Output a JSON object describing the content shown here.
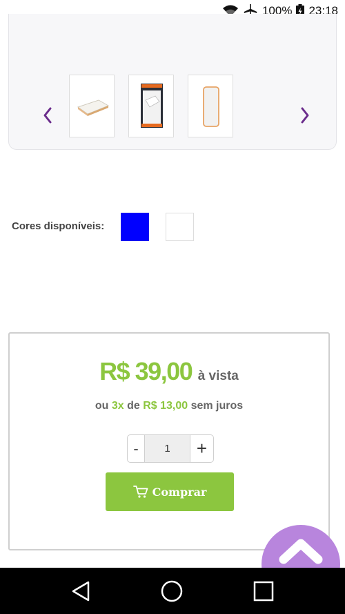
{
  "status_bar": {
    "battery": "100%",
    "time": "23:18",
    "icons": [
      "wifi-icon",
      "airplane-mode-icon",
      "battery-icon"
    ]
  },
  "gallery": {
    "thumbnails": [
      {
        "name": "product-thumbnail-1",
        "depicts": "white power bank lying flat"
      },
      {
        "name": "product-thumbnail-2",
        "depicts": "power bank in retail packaging"
      },
      {
        "name": "product-thumbnail-3",
        "depicts": "white power bank upright"
      }
    ],
    "prev_icon": "chevron-left-icon",
    "next_icon": "chevron-right-icon",
    "arrow_color": "#6b2d8c"
  },
  "colors": {
    "label": "Cores disponíveis:",
    "swatches": [
      "#0000ff",
      "#ffffff"
    ]
  },
  "purchase": {
    "price": "R$ 39,00",
    "price_suffix": "à vista",
    "installments_prefix": "ou",
    "installments_count": "3x",
    "installments_mid": "de",
    "installment_value": "R$ 13,00",
    "installments_suffix": "sem juros",
    "quantity": "1",
    "minus_label": "-",
    "plus_label": "+",
    "buy_label": "Comprar",
    "buy_icon": "cart-icon"
  },
  "scroll_top": {
    "icon": "chevron-up-icon"
  },
  "navigation": {
    "icons": [
      "back-icon",
      "home-icon",
      "recents-icon"
    ]
  },
  "colors_theme": {
    "accent_green": "#8cc63f",
    "accent_purple": "#b885dd",
    "text_gray": "#666666"
  }
}
